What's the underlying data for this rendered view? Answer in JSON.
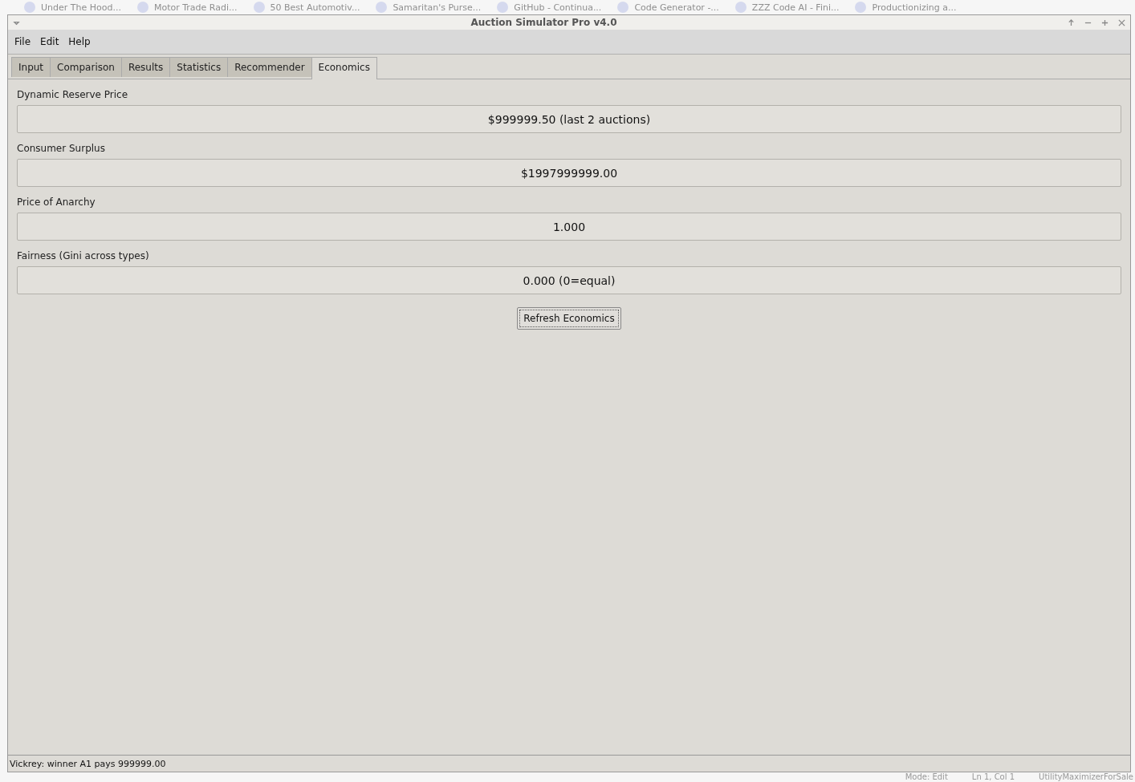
{
  "browser_tabs": [
    "Under The Hood...",
    "Motor Trade Radi...",
    "50 Best Automotiv...",
    "Samaritan's Purse...",
    "GitHub - Continua...",
    "Code Generator -...",
    "ZZZ Code AI - Fini...",
    "Productionizing a..."
  ],
  "window": {
    "title": "Auction Simulator Pro v4.0"
  },
  "menu": [
    "File",
    "Edit",
    "Help"
  ],
  "tabs": [
    {
      "label": "Input",
      "selected": false
    },
    {
      "label": "Comparison",
      "selected": false
    },
    {
      "label": "Results",
      "selected": false
    },
    {
      "label": "Statistics",
      "selected": false
    },
    {
      "label": "Recommender",
      "selected": false
    },
    {
      "label": "Economics",
      "selected": true
    }
  ],
  "metrics": [
    {
      "label": "Dynamic Reserve Price",
      "value": "$999999.50 (last 2 auctions)"
    },
    {
      "label": "Consumer Surplus",
      "value": "$1997999999.00"
    },
    {
      "label": "Price of Anarchy",
      "value": "1.000"
    },
    {
      "label": "Fairness (Gini across types)",
      "value": "0.000 (0=equal)"
    }
  ],
  "button": "Refresh Economics",
  "status_bar": "Vickrey: winner A1 pays 999999.00",
  "background_status": [
    "Mode: Edit",
    "Ln 1, Col 1",
    "UtilityMaximizerForSale"
  ]
}
